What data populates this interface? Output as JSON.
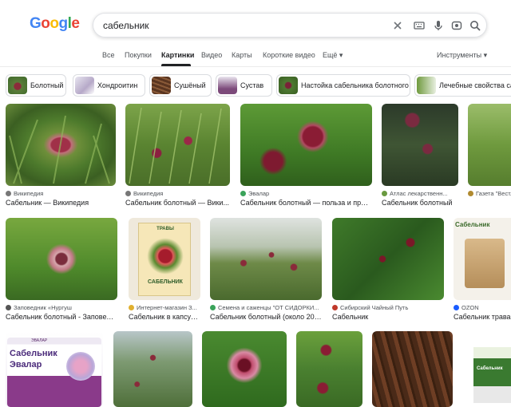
{
  "logo": [
    "G",
    "o",
    "o",
    "g",
    "l",
    "e"
  ],
  "search": {
    "query": "сабельник"
  },
  "tabs": [
    "Все",
    "Покупки",
    "Картинки",
    "Видео",
    "Карты",
    "Короткие видео",
    "Ещё ▾"
  ],
  "tools_label": "Инструменты ▾",
  "chips": [
    "Болотный",
    "Хондроитин",
    "Сушёный",
    "Сустав",
    "Настойка сабельника болотного",
    "Лечебные свойства са"
  ],
  "results": [
    {
      "source": "Википедия",
      "title": "Сабельник — Википедия"
    },
    {
      "source": "Википедия",
      "title": "Сабельник болотный — Вики..."
    },
    {
      "source": "Эвалар",
      "title": "Сабельник болотный — польза и прим..."
    },
    {
      "source": "Атлас лекарственн...",
      "title": "Сабельник болотный"
    },
    {
      "source": "Газета \"Вест...",
      "title": ""
    },
    {
      "source": "Заповедник «Нургуш",
      "title": "Сабельник болотный - Заповедн..."
    },
    {
      "source": "Интернет-магазин З...",
      "title": "Сабельник в капсул..."
    },
    {
      "source": "Семена и саженцы \"ОТ СИДОРКИ...",
      "title": "Сабельник болотный (около 200..."
    },
    {
      "source": "Сибирский Чайный Путь",
      "title": "Сабельник"
    },
    {
      "source": "OZON",
      "title": "Сабельник трава"
    }
  ],
  "product_text": {
    "box1_brand": "ЭВАЛАР",
    "box1_name": "Сабельник",
    "box1_sub": "Эвалар",
    "box2_top": "ТРАВЫ",
    "box2_name": "САБЕЛЬНИК",
    "card4": "Сабельник",
    "bottom_box": "Сабельник"
  }
}
